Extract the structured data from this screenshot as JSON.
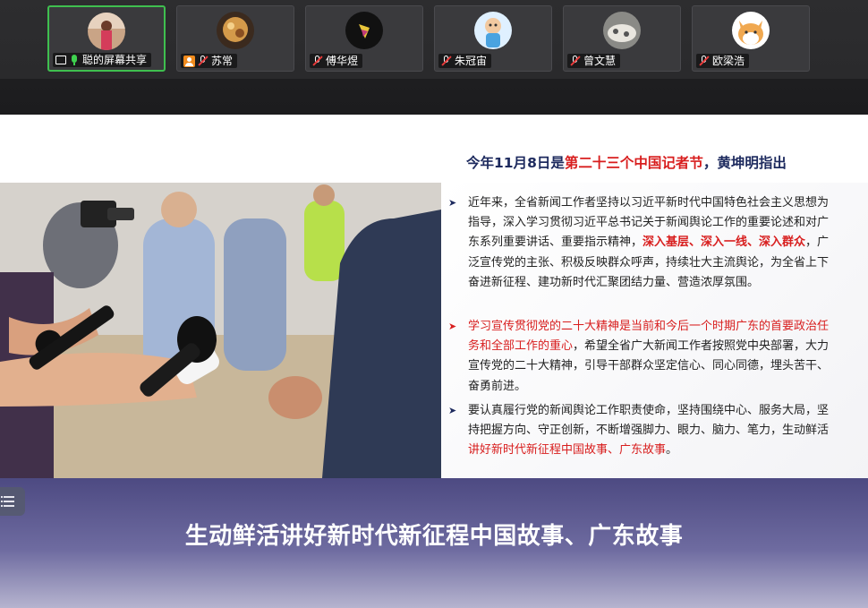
{
  "participants": [
    {
      "name": "聪的屏幕共享",
      "active": true,
      "mic": "on",
      "icons": [
        "screen-share-icon",
        "mic-on-icon"
      ]
    },
    {
      "name": "苏常",
      "active": false,
      "mic": "muted",
      "icons": [
        "person-icon",
        "mic-muted-icon"
      ]
    },
    {
      "name": "傅华煜",
      "active": false,
      "mic": "muted",
      "icons": [
        "mic-muted-icon"
      ]
    },
    {
      "name": "朱冠宙",
      "active": false,
      "mic": "muted",
      "icons": [
        "mic-muted-icon"
      ]
    },
    {
      "name": "曾文慧",
      "active": false,
      "mic": "muted",
      "icons": [
        "mic-muted-icon"
      ]
    },
    {
      "name": "欧梁浩",
      "active": false,
      "mic": "muted",
      "icons": [
        "mic-muted-icon"
      ]
    }
  ],
  "slide": {
    "headline_part1": "今年11月8日是",
    "headline_red": "第二十三个中国记者节",
    "headline_part2": "，黄坤明指出",
    "bullet1_a": "近年来，全省新闻工作者坚持以习近平新时代中国特色社会主义思想为指导，深入学习贯彻习近平总书记关于新闻舆论工作的重要论述和对广东系列重要讲话、重要指示精神，",
    "bullet1_hl": "深入基层、深入一线、深入群众",
    "bullet1_b": "，广泛宣传党的主张、积极反映群众呼声，持续壮大主流舆论，为全省上下奋进新征程、建功新时代汇聚团结力量、营造浓厚氛围。",
    "bullet2_red": "学习宣传贯彻党的二十大精神是当前和今后一个时期广东的首要政治任务和全部工作的重心",
    "bullet2_b": "，希望全省广大新闻工作者按照党中央部署，大力宣传党的二十大精神，引导干部群众坚定信心、同心同德，埋头苦干、奋勇前进。",
    "bullet3_a": "要认真履行党的新闻舆论工作职责使命，坚持围绕中心、服务大局，坚持把握方向、守正创新，不断增强脚力、眼力、脑力、笔力，生动鲜活",
    "bullet3_red": "讲好新时代新征程中国故事、广东故事",
    "bullet3_b": "。",
    "banner": "生动鲜活讲好新时代新征程中国故事、广东故事"
  },
  "colors": {
    "active_border": "#3fbf4f",
    "headline": "#1d2a5e",
    "highlight_red": "#d81e1e",
    "banner": "#4d4a82"
  }
}
